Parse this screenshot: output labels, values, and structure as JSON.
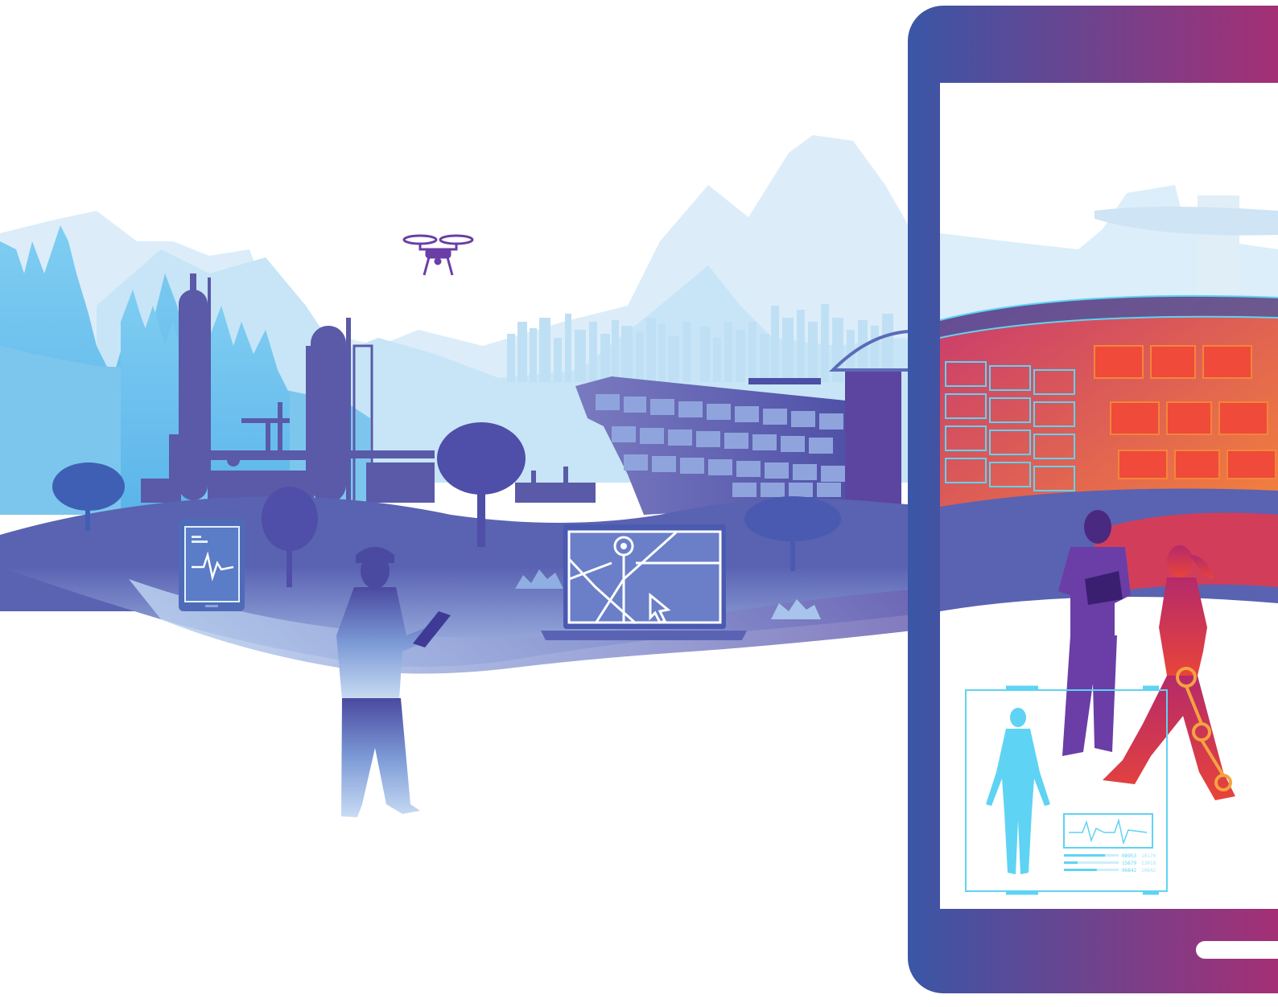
{
  "colors": {
    "mountain_far": "#dbeefa",
    "mountain_mid": "#c6e4f6",
    "city": "#bfdff3",
    "forest": "#7fc8ee",
    "industrial": "#5a5aa8",
    "building": "#5b5fb0",
    "ground_top": "#6e7cc5",
    "ground_bottom": "#9fb6e2",
    "phone_left": "#3a56a6",
    "phone_right": "#b22a6e",
    "stadium_red": "#e8443a",
    "stadium_orange": "#f07a3a",
    "cyan": "#5fd3f3",
    "nurse": "#6a3ea6",
    "walker": "#d8385a"
  },
  "icons": {
    "drone": "drone-icon",
    "tablet": "heartbeat-tablet-icon",
    "laptop": "map-laptop-icon",
    "body_scan": "body-scan-icon"
  },
  "phone_panel": {
    "readouts": [
      {
        "value": "08953",
        "sub": "10170",
        "level": 0.75
      },
      {
        "value": "15679",
        "sub": "13018",
        "level": 0.25
      },
      {
        "value": "96842",
        "sub": "10642",
        "level": 0.6
      }
    ]
  }
}
